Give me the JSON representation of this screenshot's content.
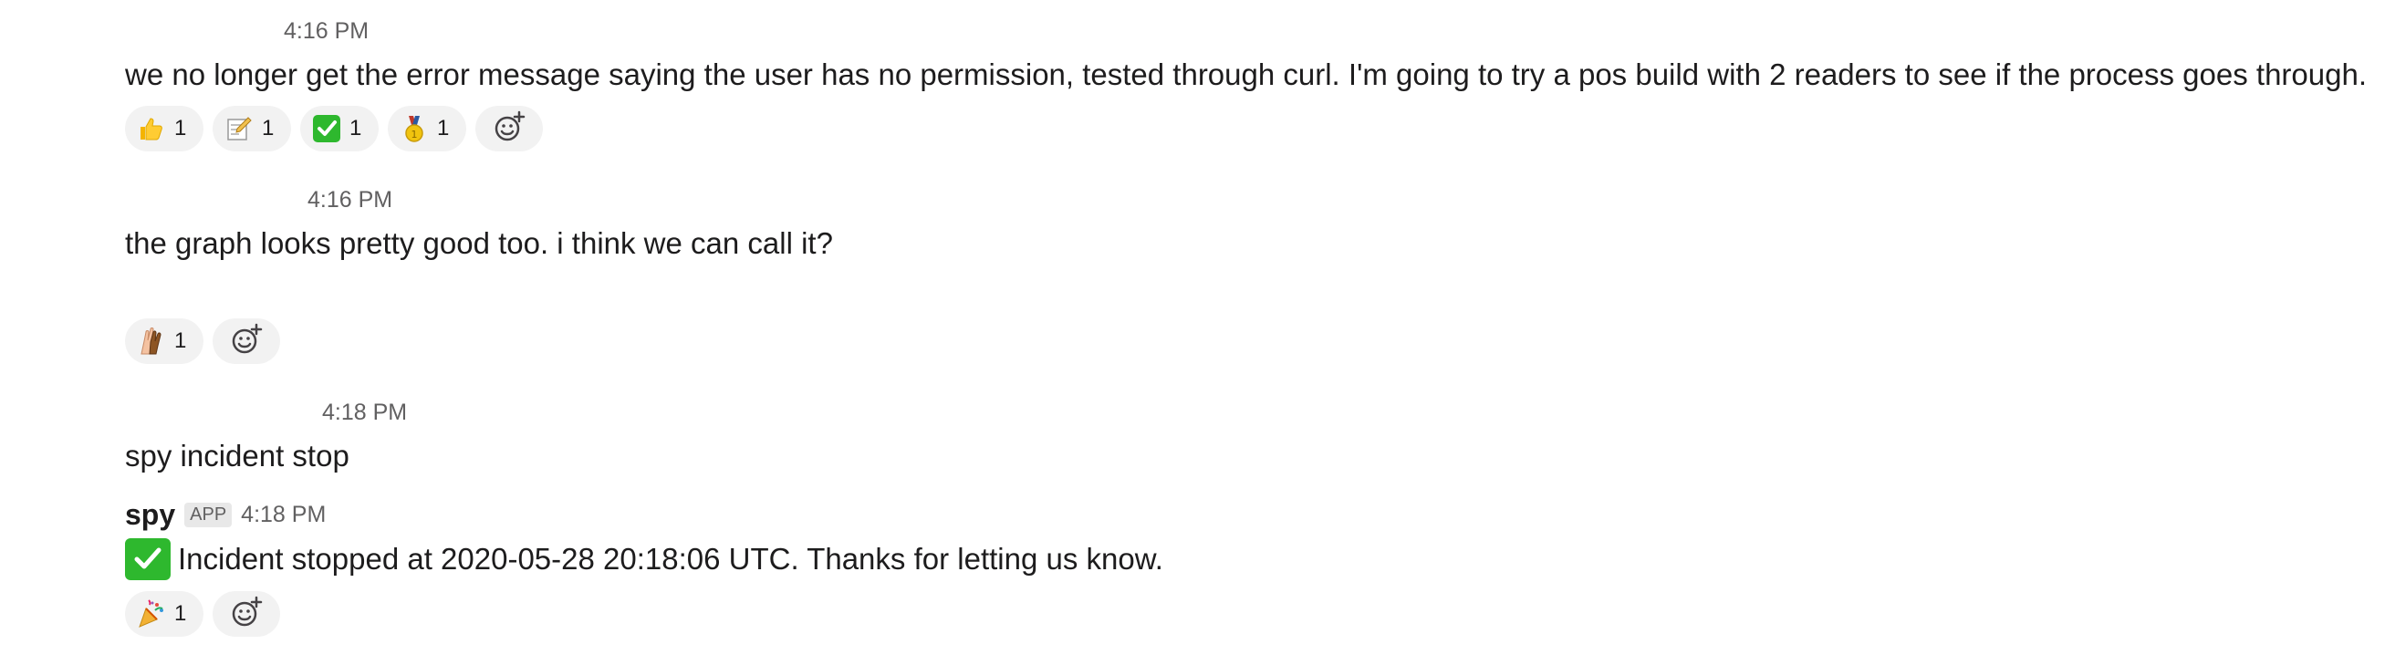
{
  "messages": [
    {
      "timestamp": "4:16 PM",
      "text": "we no longer get the error message saying the user has no permission, tested through curl. I'm going to try a pos build with 2 readers to see if the process goes through.",
      "reactions": [
        {
          "icon": "thumbs-up-icon",
          "count": "1"
        },
        {
          "icon": "memo-icon",
          "count": "1"
        },
        {
          "icon": "check-mark-icon",
          "count": "1"
        },
        {
          "icon": "medal-icon",
          "count": "1"
        }
      ]
    },
    {
      "timestamp": "4:16 PM",
      "text": "the graph looks pretty good too. i think we can call it?",
      "reactions": [
        {
          "icon": "raised-hands-icon",
          "count": "1"
        }
      ]
    },
    {
      "timestamp": "4:18 PM",
      "text": "spy incident stop"
    },
    {
      "sender": "spy",
      "badge": "APP",
      "timestamp": "4:18 PM",
      "icon": "check-mark-icon",
      "text": "Incident stopped at 2020-05-28 20:18:06 UTC. Thanks for letting us know.",
      "reactions": [
        {
          "icon": "party-popper-icon",
          "count": "1"
        }
      ]
    }
  ],
  "colors": {
    "text": "#1d1c1d",
    "muted": "#616061",
    "reaction_bg": "#f2f2f2",
    "check_green": "#2eb82e"
  }
}
